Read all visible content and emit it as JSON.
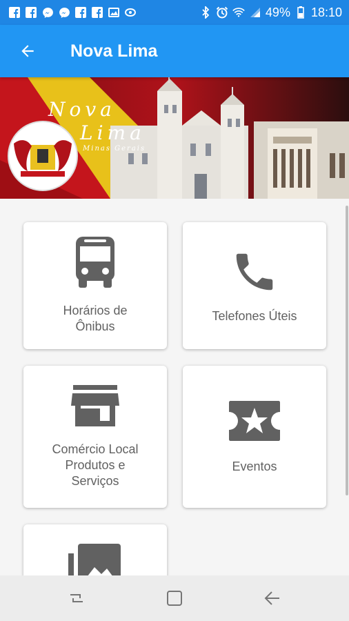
{
  "status_bar": {
    "icons_left": [
      "facebook-icon",
      "facebook-icon",
      "messenger-icon",
      "messenger-icon",
      "facebook-icon",
      "facebook-icon",
      "image-icon",
      "dot-icon"
    ],
    "icons_right": [
      "bluetooth-icon",
      "alarm-icon",
      "wifi-icon",
      "signal-icon",
      "battery-icon"
    ],
    "battery": "49%",
    "time": "18:10"
  },
  "app_bar": {
    "title": "Nova Lima",
    "color": "#2196f3"
  },
  "banner": {
    "line1": "Nova",
    "line2": "Lima",
    "subtitle": "Minas Gerais"
  },
  "menu": [
    {
      "label": "Horários de\nÔnibus",
      "icon": "bus-icon"
    },
    {
      "label": "Telefones Úteis",
      "icon": "phone-icon"
    },
    {
      "label": "Comércio Local\nProdutos e\nServiços",
      "icon": "store-icon"
    },
    {
      "label": "Eventos",
      "icon": "ticket-star-icon"
    },
    {
      "label": "",
      "icon": "photo-library-icon"
    }
  ],
  "nav": [
    "recents-icon",
    "home-icon",
    "back-icon"
  ]
}
